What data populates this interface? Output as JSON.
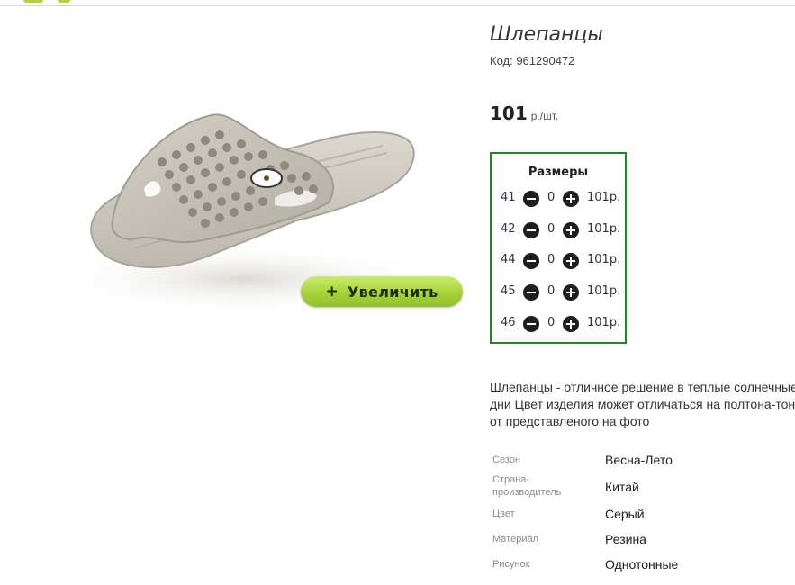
{
  "product": {
    "title": "Шлепанцы",
    "code": "Код: 961290472",
    "price_amount": "101",
    "price_unit": "р./шт."
  },
  "zoom_button": {
    "plus": "+",
    "label": "Увеличить"
  },
  "sizes": {
    "title": "Размеры",
    "rows": [
      {
        "size": "41",
        "qty": "0",
        "price": "101р."
      },
      {
        "size": "42",
        "qty": "0",
        "price": "101р."
      },
      {
        "size": "44",
        "qty": "0",
        "price": "101р."
      },
      {
        "size": "45",
        "qty": "0",
        "price": "101р."
      },
      {
        "size": "46",
        "qty": "0",
        "price": "101р."
      }
    ]
  },
  "description": "Шлепанцы - отличное решение в теплые солнечные дни Цвет изделия может отличаться на полтона-тон от представленого на фото",
  "attributes": [
    {
      "label": "Сезон",
      "value": "Весна-Лето"
    },
    {
      "label": "Страна-производитель",
      "value": "Китай"
    },
    {
      "label": "Цвет",
      "value": "Серый"
    },
    {
      "label": "Материал",
      "value": "Резина"
    },
    {
      "label": "Рисунок",
      "value": "Однотонные"
    }
  ],
  "colors": {
    "accent_green": "#a6d23a",
    "sizes_border": "#1f8a1f"
  }
}
